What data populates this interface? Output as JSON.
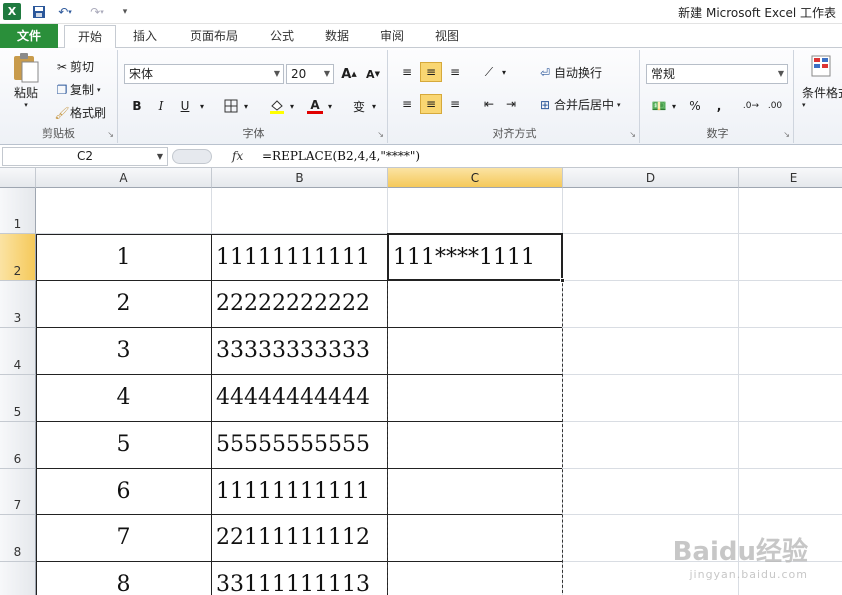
{
  "titlebar": {
    "app_icon": "X",
    "save_icon": "save-icon",
    "undo_icon": "undo-icon",
    "redo_icon": "redo-icon",
    "title": "新建 Microsoft Excel 工作表"
  },
  "tabs": [
    {
      "label": "文件"
    },
    {
      "label": "开始"
    },
    {
      "label": "插入"
    },
    {
      "label": "页面布局"
    },
    {
      "label": "公式"
    },
    {
      "label": "数据"
    },
    {
      "label": "审阅"
    },
    {
      "label": "视图"
    }
  ],
  "ribbon": {
    "clipboard": {
      "label": "剪贴板",
      "paste": "粘贴",
      "cut": "剪切",
      "copy": "复制",
      "format_painter": "格式刷"
    },
    "font": {
      "label": "字体",
      "font_name": "宋体",
      "font_size": "20",
      "grow": "A",
      "shrink": "A",
      "bold": "B",
      "italic": "I",
      "underline": "U",
      "phonetic": "变"
    },
    "alignment": {
      "label": "对齐方式",
      "wrap_text": "自动换行",
      "merge_center": "合并后居中"
    },
    "number": {
      "label": "数字",
      "format": "常规",
      "percent": "%",
      "comma": ","
    },
    "styles": {
      "conditional_format": "条件格式"
    }
  },
  "formula_bar": {
    "name_box": "C2",
    "fx": "fx",
    "formula": "=REPLACE(B2,4,4,\"****\")"
  },
  "grid": {
    "columns": [
      "A",
      "B",
      "C",
      "D",
      "E"
    ],
    "selected_column": "C",
    "selected_row": "2",
    "rows": [
      {
        "num": "1",
        "A": "",
        "B": "",
        "C": ""
      },
      {
        "num": "2",
        "A": "1",
        "B": "11111111111",
        "C": "111****1111"
      },
      {
        "num": "3",
        "A": "2",
        "B": "22222222222",
        "C": ""
      },
      {
        "num": "4",
        "A": "3",
        "B": "33333333333",
        "C": ""
      },
      {
        "num": "5",
        "A": "4",
        "B": "44444444444",
        "C": ""
      },
      {
        "num": "6",
        "A": "5",
        "B": "55555555555",
        "C": ""
      },
      {
        "num": "7",
        "A": "6",
        "B": "11111111111",
        "C": ""
      },
      {
        "num": "8",
        "A": "7",
        "B": "22111111112",
        "C": ""
      },
      {
        "num": "",
        "A": "8",
        "B": "33111111113",
        "C": ""
      }
    ]
  },
  "watermark": {
    "main": "Baidu经验",
    "sub": "jingyan.baidu.com"
  }
}
